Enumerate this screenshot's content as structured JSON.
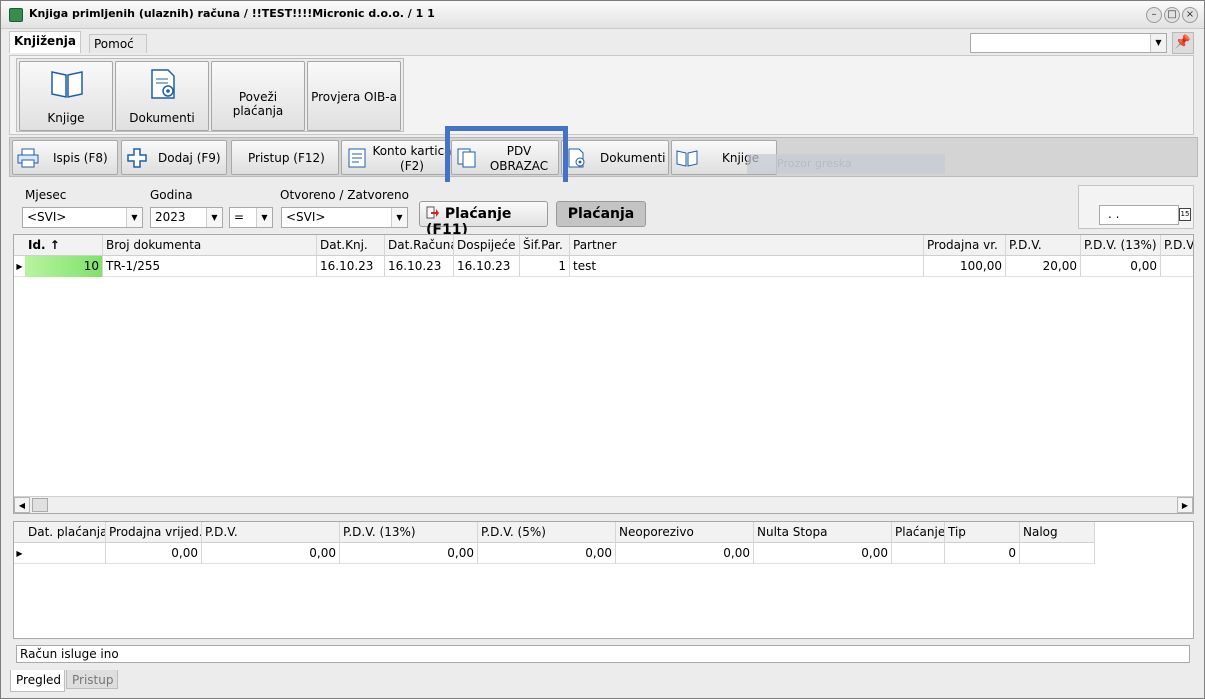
{
  "window": {
    "title": "Knjiga primljenih (ulaznih) računa / !!TEST!!!!Micronic d.o.o. / 1 1"
  },
  "ribbon": {
    "tabs": [
      {
        "label": "Knjiženja",
        "active": true
      },
      {
        "label": "Pomoć",
        "active": false
      }
    ],
    "buttons": [
      {
        "label": "Knjige",
        "icon": "book-icon"
      },
      {
        "label": "Dokumenti",
        "icon": "document-gear-icon"
      },
      {
        "label": "Poveži plaćanja"
      },
      {
        "label": "Provjera OIB-a"
      }
    ]
  },
  "toolbar": {
    "ispis": "Ispis (F8)",
    "dodaj": "Dodaj (F9)",
    "pristup": "Pristup (F12)",
    "konto_line1": "Konto kartica",
    "konto_line2": "(F2)",
    "pdv_line1": "PDV",
    "pdv_line2": "OBRAZAC",
    "dokumenti": "Dokumenti",
    "knjige": "Knjige",
    "ghost": "Prozor greska"
  },
  "filters": {
    "mjesec_label": "Mjesec",
    "mjesec_value": "<SVI>",
    "godina_label": "Godina",
    "godina_value": "2023",
    "operator_value": "=",
    "status_label": "Otvoreno / Zatvoreno",
    "status_value": "<SVI>",
    "placanje_f11": "Plaćanje (F11)",
    "placanja": "Plaćanja",
    "date_value": " .  ."
  },
  "grid": {
    "headers": [
      "Id. ↑",
      "Broj dokumenta",
      "Dat.Knj.",
      "Dat.Računa",
      "Dospijeće",
      "Šif.Par.",
      "Partner",
      "Prodajna vr.",
      "P.D.V.",
      "P.D.V. (13%)",
      "P.D.V"
    ],
    "rows": [
      [
        "10",
        "TR-1/255",
        "16.10.23",
        "16.10.23",
        "16.10.23",
        "1",
        "test",
        "100,00",
        "20,00",
        "0,00",
        ""
      ]
    ]
  },
  "grid2": {
    "headers": [
      "Dat. plaćanja",
      "Prodajna vrijed.",
      "P.D.V.",
      "P.D.V. (13%)",
      "P.D.V. (5%)",
      "Neoporezivo",
      "Nulta Stopa",
      "Plaćanje",
      "Tip",
      "Nalog"
    ],
    "rows": [
      [
        "",
        "0,00",
        "0,00",
        "0,00",
        "0,00",
        "0,00",
        "0,00",
        "",
        "0",
        ""
      ]
    ]
  },
  "memo": "Račun isluge ino",
  "bottom_tabs": [
    {
      "label": "Pregled",
      "active": true
    },
    {
      "label": "Pristup",
      "active": false
    }
  ]
}
